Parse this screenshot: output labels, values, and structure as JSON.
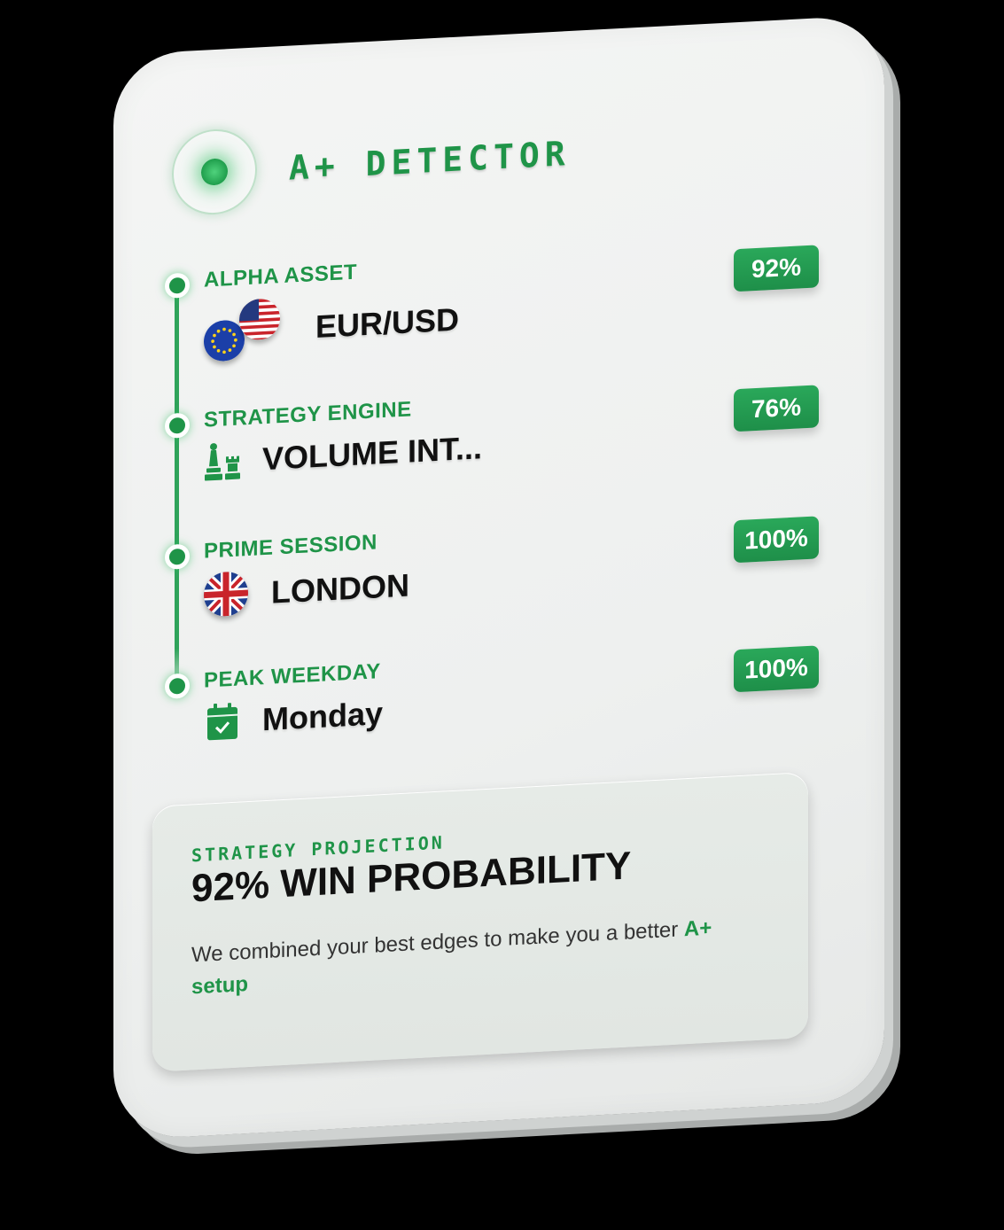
{
  "header": {
    "title": "A+ DETECTOR"
  },
  "rows": [
    {
      "label": "ALPHA ASSET",
      "value": "EUR/USD",
      "percent": "92%",
      "icon": "eu-us-flags-icon"
    },
    {
      "label": "STRATEGY ENGINE",
      "value": "VOLUME INT...",
      "percent": "76%",
      "icon": "chess-pieces-icon"
    },
    {
      "label": "PRIME SESSION",
      "value": "LONDON",
      "percent": "100%",
      "icon": "uk-flag-icon"
    },
    {
      "label": "PEAK WEEKDAY",
      "value": "Monday",
      "percent": "100%",
      "icon": "calendar-check-icon"
    }
  ],
  "projection": {
    "kicker": "STRATEGY PROJECTION",
    "headline": "92% WIN PROBABILITY",
    "description": "We combined your best edges to make you a better",
    "accent": "A+ setup"
  },
  "colors": {
    "accent": "#1f9448",
    "badge": "#25a056",
    "background": "#000000",
    "card": "#f2f3f2"
  }
}
